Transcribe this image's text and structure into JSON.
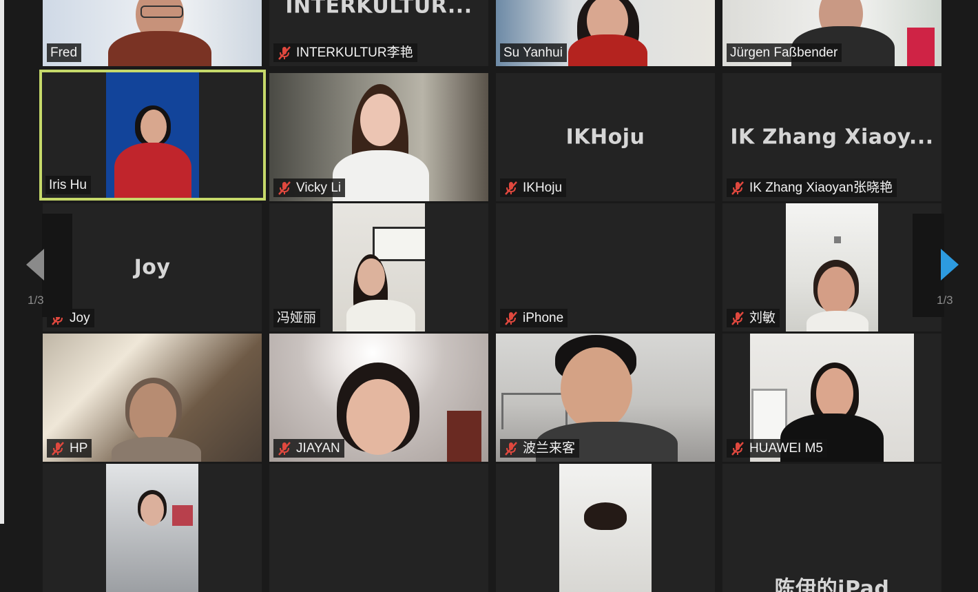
{
  "participants": [
    {
      "name": "Fred",
      "muted": false
    },
    {
      "name": "INTERKULTUR李艳",
      "muted": true,
      "avatar_text": "INTERKULTUR..."
    },
    {
      "name": "Su Yanhui",
      "muted": false
    },
    {
      "name": "Jürgen Faßbender",
      "muted": false
    },
    {
      "name": "Iris Hu",
      "muted": false,
      "active_speaker": true
    },
    {
      "name": "Vicky Li",
      "muted": true
    },
    {
      "name": "IKHoju",
      "muted": true,
      "avatar_text": "IKHoju"
    },
    {
      "name": "IK Zhang Xiaoyan张晓艳",
      "muted": true,
      "avatar_text": "IK Zhang Xiaoy..."
    },
    {
      "name": "Joy",
      "muted": true,
      "avatar_text": "Joy"
    },
    {
      "name": "冯娅丽",
      "muted": false
    },
    {
      "name": "iPhone",
      "muted": true
    },
    {
      "name": "刘敏",
      "muted": true
    },
    {
      "name": "HP",
      "muted": true
    },
    {
      "name": "JIAYAN",
      "muted": true
    },
    {
      "name": "波兰来客",
      "muted": true
    },
    {
      "name": "HUAWEI M5",
      "muted": true
    },
    {
      "name": "",
      "muted": false
    },
    {
      "name": "",
      "muted": false
    },
    {
      "name": "",
      "muted": false
    },
    {
      "name": "",
      "muted": false,
      "avatar_text": "陈伊的iPad"
    }
  ],
  "pagination": {
    "left_label": "1/3",
    "right_label": "1/3"
  },
  "colors": {
    "active_border": "#c6d96a",
    "next_arrow": "#2d9be0",
    "prev_arrow": "#8a8a8a",
    "mic_off": "#e0483e"
  }
}
